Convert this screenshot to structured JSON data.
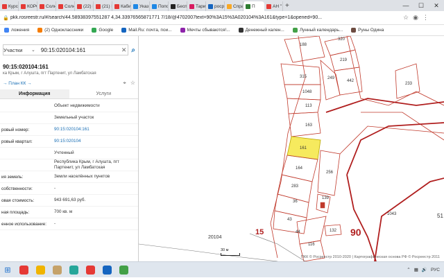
{
  "browser": {
    "tabs": [
      {
        "label": "Курс",
        "color": "#e53935"
      },
      {
        "label": "КОРС",
        "color": "#e53935"
      },
      {
        "label": "Солн",
        "color": "#e53935"
      },
      {
        "label": "Солн",
        "color": "#e53935"
      },
      {
        "label": "(22) Н",
        "color": "#e53935"
      },
      {
        "label": "(21) М",
        "color": "#e53935"
      },
      {
        "label": "Каби",
        "color": "#e53935"
      },
      {
        "label": "Указ",
        "color": "#1e88e5"
      },
      {
        "label": "Попо",
        "color": "#1e88e5"
      },
      {
        "label": "Бесп",
        "color": "#222222"
      },
      {
        "label": "Тари",
        "color": "#d81b60"
      },
      {
        "label": "роср",
        "color": "#1565c0"
      },
      {
        "label": "Спра",
        "color": "#f9a825"
      },
      {
        "label": "П",
        "color": "#2e7d32"
      },
      {
        "label": "АН \"",
        "color": "#e53935"
      }
    ],
    "url": "pkk.rosreestr.ru/#/search/44.58938397551287 4,34.33976565871771 7/18/@4702007text=90%3A15%3A020104%3A161&type=1&opened=90...",
    "bookmarks": [
      {
        "label": "ложения",
        "color": "#4285f4"
      },
      {
        "label": "(2) Одноклассники",
        "color": "#f57c00"
      },
      {
        "label": "Google",
        "color": "#34a853"
      },
      {
        "label": "Mail.Ru: почта, пои...",
        "color": "#1565c0"
      },
      {
        "label": "Мечты сбываются!...",
        "color": "#8e24aa"
      },
      {
        "label": "Денежный кален...",
        "color": "#333333"
      },
      {
        "label": "Лунный календарь...",
        "color": "#43a047"
      },
      {
        "label": "Руны Одина",
        "color": "#6d4c41"
      }
    ]
  },
  "panel": {
    "search_select": "Участки",
    "search_value": "90:15:020104:161",
    "title": "90:15:020104:161",
    "address": "ка Крым, г Алушта, пгт Партенит, ул Ламбатская",
    "plan_link": "→ План КК →",
    "tab_info": "Информация",
    "tab_services": "Услуги",
    "rows": [
      {
        "k": "",
        "v": "Объект недвижимости",
        "link": false
      },
      {
        "k": "",
        "v": "Земельный участок",
        "link": false
      },
      {
        "k": "ровый номер:",
        "v": "90:15:020104:161",
        "link": true
      },
      {
        "k": "ровый квартал:",
        "v": "90:15:020104",
        "link": true
      },
      {
        "k": "",
        "v": "Учтенный",
        "link": false
      },
      {
        "k": "",
        "v": "Республика Крым, г Алушта, пгт Партенит, ул Ламбатская",
        "link": false
      },
      {
        "k": "ия земель:",
        "v": "Земли населённых пунктов",
        "link": false
      },
      {
        "k": "собственности:",
        "v": "-",
        "link": false
      },
      {
        "k": "овая стоимость:",
        "v": "943 691,63 руб.",
        "link": false
      },
      {
        "k": "ная площадь:",
        "v": "700 кв. м",
        "link": false
      },
      {
        "k": "енное использование:",
        "v": "-",
        "link": false
      }
    ]
  },
  "map": {
    "labels": [
      {
        "t": "188"
      },
      {
        "t": "320"
      },
      {
        "t": "219"
      },
      {
        "t": "442"
      },
      {
        "t": "249"
      },
      {
        "t": "315"
      },
      {
        "t": "1048"
      },
      {
        "t": "113"
      },
      {
        "t": "163"
      },
      {
        "t": "161"
      },
      {
        "t": "164"
      },
      {
        "t": "256"
      },
      {
        "t": "283"
      },
      {
        "t": "36"
      },
      {
        "t": "43"
      },
      {
        "t": "44"
      },
      {
        "t": "116"
      },
      {
        "t": "132"
      },
      {
        "t": "139"
      },
      {
        "t": "233"
      },
      {
        "t": "1043"
      },
      {
        "t": "15"
      },
      {
        "t": "90"
      },
      {
        "t": "20104"
      },
      {
        "t": "51"
      }
    ],
    "scale_label": "30 м",
    "attribution": "ПКК © Росреестр 2010-2020 | Картографическая основа РФ © Росреестр 2011"
  },
  "taskbar": {
    "apps": [
      "#e53935",
      "#f0b400",
      "#c5a26a",
      "#26a69a",
      "#e53935",
      "#1565c0",
      "#43a047"
    ],
    "lang": "РУС"
  }
}
